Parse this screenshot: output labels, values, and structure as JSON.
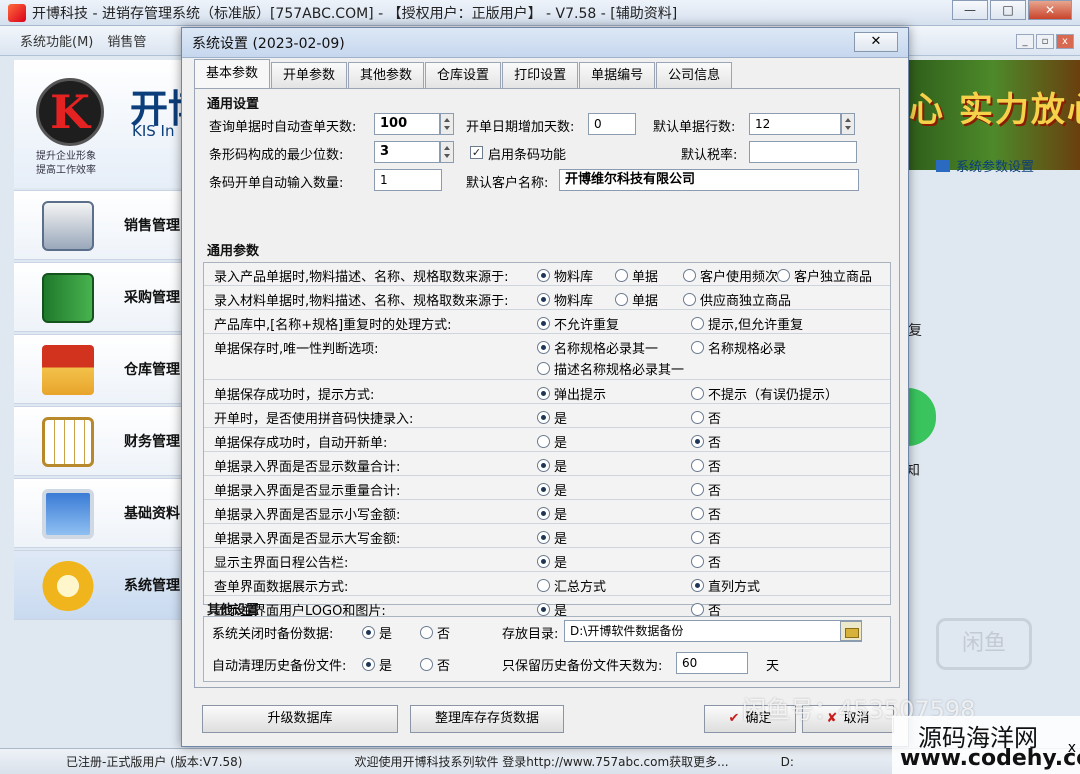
{
  "window": {
    "title": "开博科技 - 进销存管理系统（标准版）[757ABC.COM] - 【授权用户：正版用户】 - V7.58 - [辅助资料]",
    "min": "—",
    "max": "□",
    "close": "✕"
  },
  "menubar": {
    "items": [
      "系统功能(M)",
      "销售管"
    ]
  },
  "mdi": {
    "min": "_",
    "max": "▫",
    "close": "x"
  },
  "brand": {
    "name": "开博",
    "sub": "KIS In",
    "slogan1": "提升企业形象",
    "slogan2": "提高工作效率"
  },
  "nav": {
    "items": [
      "销售管理",
      "采购管理",
      "仓库管理",
      "财务管理",
      "基础资料",
      "系统管理"
    ]
  },
  "banner": {
    "text": "心 实力放心"
  },
  "sys_param_link": "系统参数设置",
  "bg_fragments": {
    "restore": "复",
    "know": "知",
    "watermark": "闲鱼"
  },
  "statusbar": {
    "registered": "已注册-正式版用户  (版本:V7.58)",
    "welcome": "欢迎使用开博科技系列软件   登录http://www.757abc.com获取更多...",
    "path": "D:"
  },
  "dialog": {
    "title": "系统设置 (2023-02-09)",
    "close": "✕",
    "tabs": [
      "基本参数",
      "开单参数",
      "其他参数",
      "仓库设置",
      "打印设置",
      "单据编号",
      "公司信息"
    ],
    "general": {
      "heading": "通用设置",
      "query_days_label": "查询单据时自动查单天数:",
      "query_days": "100",
      "open_date_add_label": "开单日期增加天数:",
      "open_date_add": "0",
      "default_rows_label": "默认单据行数:",
      "default_rows": "12",
      "barcode_min_label": "条形码构成的最少位数:",
      "barcode_min": "3",
      "enable_barcode_label": "启用条码功能",
      "enable_barcode_checked": "✓",
      "default_tax_label": "默认税率:",
      "default_tax": "",
      "barcode_auto_qty_label": "条码开单自动输入数量:",
      "barcode_auto_qty": "1",
      "default_customer_label": "默认客户名称:",
      "default_customer": "开博维尔科技有限公司"
    },
    "params": {
      "heading": "通用参数",
      "rows": [
        {
          "q": "录入产品单据时,物料描述、名称、规格取数来源于:",
          "opts": [
            "物料库",
            "单据",
            "客户使用频次",
            "客户独立商品"
          ],
          "sel": 0
        },
        {
          "q": "录入材料单据时,物料描述、名称、规格取数来源于:",
          "opts": [
            "物料库",
            "单据",
            "供应商独立商品"
          ],
          "sel": 0
        },
        {
          "q": "产品库中,[名称+规格]重复时的处理方式:",
          "opts": [
            "不允许重复",
            "提示,但允许重复"
          ],
          "sel": 0
        },
        {
          "q": "单据保存时,唯一性判断选项:",
          "opts": [
            "名称规格必录其一",
            "名称规格必录",
            "描述名称规格必录其一"
          ],
          "sel": 0
        },
        {
          "q": "单据保存成功时，提示方式:",
          "opts": [
            "弹出提示",
            "不提示（有误仍提示）"
          ],
          "sel": 0
        },
        {
          "q": "开单时，是否使用拼音码快捷录入:",
          "opts": [
            "是",
            "否"
          ],
          "sel": 0
        },
        {
          "q": "单据保存成功时，自动开新单:",
          "opts": [
            "是",
            "否"
          ],
          "sel": 1
        },
        {
          "q": "单据录入界面是否显示数量合计:",
          "opts": [
            "是",
            "否"
          ],
          "sel": 0
        },
        {
          "q": "单据录入界面是否显示重量合计:",
          "opts": [
            "是",
            "否"
          ],
          "sel": 0
        },
        {
          "q": "单据录入界面是否显示小写金额:",
          "opts": [
            "是",
            "否"
          ],
          "sel": 0
        },
        {
          "q": "单据录入界面是否显示大写金额:",
          "opts": [
            "是",
            "否"
          ],
          "sel": 0
        },
        {
          "q": "显示主界面日程公告栏:",
          "opts": [
            "是",
            "否"
          ],
          "sel": 0
        },
        {
          "q": "查单界面数据展示方式:",
          "opts": [
            "汇总方式",
            "直列方式"
          ],
          "sel": 1
        },
        {
          "q": "显示主界面用户LOGO和图片:",
          "opts": [
            "是",
            "否"
          ],
          "sel": 0
        }
      ]
    },
    "other": {
      "heading": "其他设置",
      "backup_on_close_label": "系统关闭时备份数据:",
      "backup_on_close_opts": [
        "是",
        "否"
      ],
      "backup_on_close_sel": 0,
      "dir_label": "存放目录:",
      "dir": "D:\\开博软件数据备份",
      "auto_clean_label": "自动清理历史备份文件:",
      "auto_clean_opts": [
        "是",
        "否"
      ],
      "auto_clean_sel": 0,
      "keep_days_label": "只保留历史备份文件天数为:",
      "keep_days": "60",
      "keep_days_unit": "天"
    },
    "buttons": {
      "upgrade": "升级数据库",
      "tidy": "整理库存存货数据",
      "ok": "确定",
      "cancel": "取消",
      "ok_glyph": "✔",
      "cancel_glyph": "✘"
    }
  },
  "watermarks": {
    "overlay": "闲鱼号：453507598",
    "site_cn": "源码海洋网",
    "site_url": "www.codehy.com",
    "x": "x"
  }
}
